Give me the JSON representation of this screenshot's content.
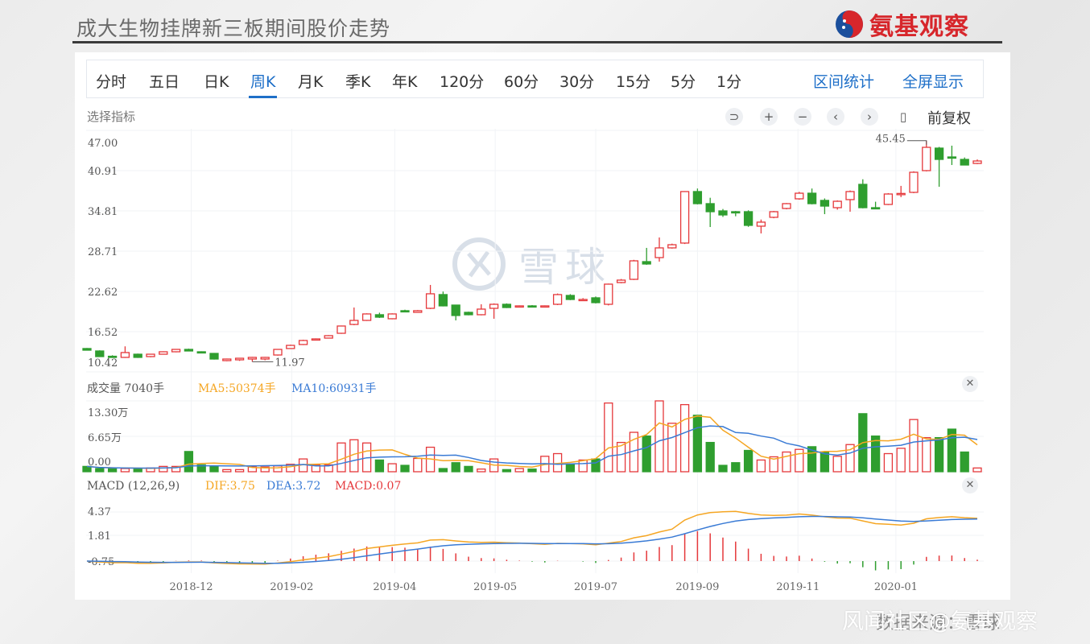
{
  "header": {
    "title": "成大生物挂牌新三板期间股价走势",
    "brand": "氨基观察"
  },
  "tabs": [
    {
      "label": "分时"
    },
    {
      "label": "五日"
    },
    {
      "label": "日K"
    },
    {
      "label": "周K",
      "active": true
    },
    {
      "label": "月K"
    },
    {
      "label": "季K"
    },
    {
      "label": "年K"
    },
    {
      "label": "120分"
    },
    {
      "label": "60分"
    },
    {
      "label": "30分"
    },
    {
      "label": "15分"
    },
    {
      "label": "5分"
    },
    {
      "label": "1分"
    }
  ],
  "links": {
    "range_stats": "区间统计",
    "fullscreen": "全屏显示"
  },
  "toolbar": {
    "select_indicator": "选择指标",
    "adjust": "前复权",
    "icons": [
      "undo-icon",
      "zoom-in-icon",
      "zoom-out-icon",
      "pan-left-icon",
      "pan-right-icon",
      "candle-style-icon"
    ]
  },
  "volume_header": {
    "title": "成交量",
    "value": "7040手",
    "ma5": "MA5:50374手",
    "ma10": "MA10:60931手"
  },
  "macd_header": {
    "title": "MACD (12,26,9)",
    "dif": "DIF:3.75",
    "dea": "DEA:3.72",
    "macd": "MACD:0.07"
  },
  "watermark": "雪球",
  "footer": {
    "source": "数据来源：雪球",
    "community": "风闻社区@氨基观察"
  },
  "colors": {
    "up": "#e5383b",
    "down": "#2f9e2f",
    "ma5": "#f5a623",
    "ma10": "#3a7bd5",
    "accent": "#1e6fc8"
  },
  "chart_data": {
    "type": "candlestick",
    "title": "成大生物挂牌新三板期间股价走势",
    "interval": "weekly",
    "price_axis": {
      "ticks": [
        "47.00",
        "40.91",
        "34.81",
        "28.71",
        "22.62",
        "16.52",
        "10.42"
      ],
      "range": [
        10.42,
        47.0
      ]
    },
    "annotations": [
      {
        "label": "45.45",
        "candle": 67,
        "type": "high"
      },
      {
        "label": "11.97",
        "candle": 14,
        "type": "low"
      }
    ],
    "x_ticks": [
      {
        "label": "2018-12",
        "index": 9.2
      },
      {
        "label": "2019-02",
        "index": 17.1
      },
      {
        "label": "2019-04",
        "index": 25.2
      },
      {
        "label": "2019-05",
        "index": 33.1
      },
      {
        "label": "2019-07",
        "index": 41
      },
      {
        "label": "2019-09",
        "index": 49
      },
      {
        "label": "2019-11",
        "index": 56.9
      },
      {
        "label": "2020-01",
        "index": 64.6
      }
    ],
    "ohlc_fields": [
      "open",
      "high",
      "low",
      "close"
    ],
    "ohlc": [
      [
        13.97,
        14.05,
        13.7,
        13.72
      ],
      [
        13.6,
        13.7,
        12.7,
        12.75
      ],
      [
        12.8,
        12.95,
        12.6,
        12.7
      ],
      [
        12.63,
        14.3,
        12.55,
        13.36
      ],
      [
        13.11,
        13.2,
        12.55,
        12.63
      ],
      [
        12.75,
        13.15,
        12.65,
        13.11
      ],
      [
        13.11,
        13.55,
        13.05,
        13.48
      ],
      [
        13.48,
        13.9,
        13.4,
        13.84
      ],
      [
        13.84,
        13.95,
        13.55,
        13.6
      ],
      [
        13.48,
        13.55,
        13.3,
        13.36
      ],
      [
        13.23,
        13.3,
        12.3,
        12.38
      ],
      [
        12.14,
        12.45,
        12.05,
        12.38
      ],
      [
        12.26,
        12.55,
        12.1,
        12.5
      ],
      [
        12.38,
        12.7,
        11.97,
        12.63
      ],
      [
        12.38,
        12.7,
        12.2,
        12.63
      ],
      [
        12.99,
        13.9,
        12.9,
        13.84
      ],
      [
        13.97,
        14.55,
        13.9,
        14.45
      ],
      [
        14.58,
        15.3,
        14.5,
        15.19
      ],
      [
        15.31,
        15.5,
        15.25,
        15.43
      ],
      [
        15.55,
        16.0,
        15.5,
        15.92
      ],
      [
        16.28,
        17.45,
        16.2,
        17.38
      ],
      [
        17.62,
        20.18,
        17.5,
        18.23
      ],
      [
        18.23,
        19.3,
        18.15,
        19.21
      ],
      [
        19.09,
        19.4,
        18.6,
        18.72
      ],
      [
        18.48,
        19.3,
        18.4,
        19.21
      ],
      [
        19.7,
        19.85,
        19.5,
        19.57
      ],
      [
        19.45,
        19.8,
        19.4,
        19.7
      ],
      [
        20.06,
        23.6,
        19.95,
        22.26
      ],
      [
        22.14,
        22.6,
        20.35,
        20.43
      ],
      [
        20.55,
        20.6,
        18.23,
        18.97
      ],
      [
        19.45,
        19.55,
        19.0,
        19.09
      ],
      [
        19.09,
        20.67,
        19.0,
        19.94
      ],
      [
        20.06,
        20.8,
        18.48,
        20.67
      ],
      [
        20.67,
        20.8,
        20.1,
        20.18
      ],
      [
        20.31,
        20.5,
        20.2,
        20.43
      ],
      [
        20.43,
        20.55,
        20.25,
        20.31
      ],
      [
        20.31,
        20.5,
        20.2,
        20.43
      ],
      [
        20.67,
        22.3,
        20.55,
        22.14
      ],
      [
        22.01,
        22.2,
        21.3,
        21.4
      ],
      [
        21.28,
        21.6,
        21.2,
        21.4
      ],
      [
        21.65,
        21.85,
        20.8,
        20.92
      ],
      [
        20.67,
        23.8,
        20.5,
        23.72
      ],
      [
        23.96,
        24.5,
        23.85,
        24.33
      ],
      [
        24.45,
        27.4,
        24.35,
        27.25
      ],
      [
        27.13,
        29.21,
        26.65,
        26.77
      ],
      [
        27.74,
        30.79,
        27.13,
        29.21
      ],
      [
        29.21,
        29.85,
        29.1,
        29.69
      ],
      [
        29.94,
        37.8,
        29.8,
        37.74
      ],
      [
        37.74,
        38.2,
        35.8,
        35.91
      ],
      [
        35.91,
        36.8,
        32.37,
        34.69
      ],
      [
        34.81,
        35.1,
        33.9,
        34.2
      ],
      [
        34.69,
        34.8,
        34.0,
        34.57
      ],
      [
        34.69,
        34.9,
        32.4,
        32.62
      ],
      [
        32.5,
        33.5,
        31.4,
        33.11
      ],
      [
        33.84,
        34.8,
        33.7,
        34.69
      ],
      [
        35.18,
        36.0,
        35.05,
        35.91
      ],
      [
        36.64,
        37.7,
        36.5,
        37.49
      ],
      [
        37.49,
        38.2,
        35.8,
        35.91
      ],
      [
        36.4,
        36.7,
        34.32,
        35.54
      ],
      [
        35.3,
        36.4,
        35.0,
        36.27
      ],
      [
        36.52,
        37.9,
        34.69,
        37.74
      ],
      [
        38.83,
        39.6,
        35.2,
        35.3
      ],
      [
        35.3,
        36.2,
        35.1,
        35.18
      ],
      [
        35.79,
        37.5,
        35.7,
        37.37
      ],
      [
        37.3,
        38.6,
        36.9,
        37.45
      ],
      [
        37.62,
        40.8,
        37.5,
        40.66
      ],
      [
        40.91,
        45.45,
        40.8,
        44.44
      ],
      [
        44.32,
        44.5,
        38.47,
        42.61
      ],
      [
        42.98,
        44.69,
        41.76,
        42.86
      ],
      [
        42.61,
        42.9,
        41.7,
        41.76
      ],
      [
        42.0,
        42.6,
        41.9,
        42.37
      ]
    ],
    "volume_unit": "万手",
    "volume_axis": {
      "ticks": [
        "13.30万",
        "6.65万",
        "0.00"
      ],
      "range": [
        0,
        13.3
      ]
    },
    "volume": [
      1.0,
      0.6,
      0.6,
      0.6,
      0.6,
      0.7,
      1.0,
      1.0,
      3.8,
      1.3,
      1.0,
      0.4,
      0.4,
      0.9,
      0.9,
      1.1,
      1.4,
      2.4,
      1.3,
      1.3,
      5.4,
      6.0,
      5.4,
      2.2,
      1.5,
      1.2,
      2.5,
      4.6,
      0.6,
      1.7,
      1.0,
      0.5,
      2.4,
      0.4,
      0.6,
      0.5,
      2.9,
      3.4,
      1.4,
      2.2,
      2.4,
      12.9,
      5.5,
      7.4,
      6.7,
      13.3,
      9.1,
      12.6,
      10.6,
      5.5,
      1.2,
      1.7,
      4.0,
      2.2,
      2.8,
      3.7,
      4.2,
      4.7,
      3.7,
      2.9,
      5.1,
      10.9,
      6.7,
      3.4,
      4.4,
      9.8,
      6.4,
      6.4,
      8.0,
      3.7,
      0.704
    ],
    "macd_axis": {
      "ticks": [
        "4.37",
        "1.81",
        "-0.75"
      ],
      "range": [
        -0.75,
        5.5
      ]
    },
    "macd_params": [
      12,
      26,
      9
    ]
  }
}
